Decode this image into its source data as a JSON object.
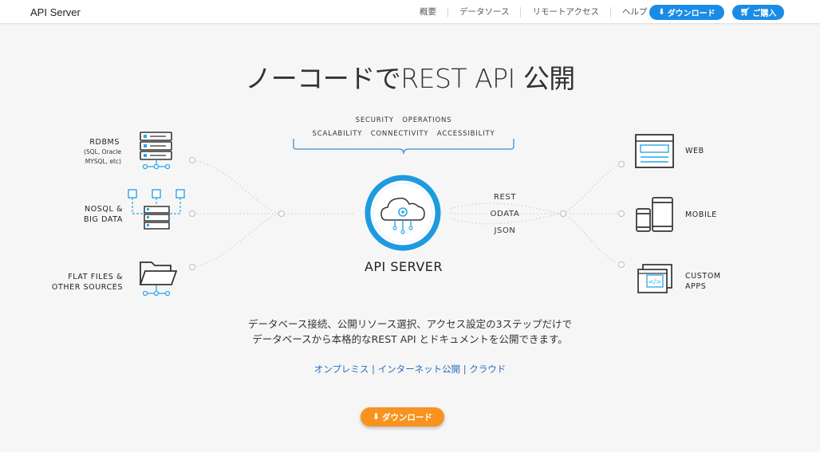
{
  "header": {
    "brand": "API Server",
    "nav": [
      "概要",
      "データソース",
      "リモートアクセス",
      "ヘルプ"
    ],
    "download_label": "ダウンロード",
    "buy_label": "ご購入"
  },
  "hero": {
    "title": "ノーコードでREST API 公開"
  },
  "diagram": {
    "features_top": "SECURITY   OPERATIONS",
    "features_bottom": "SCALABILITY   CONNECTIVITY   ACCESSIBILITY",
    "center_label": "API SERVER",
    "protocols": [
      "REST",
      "ODATA",
      "JSON"
    ],
    "sources": [
      {
        "title": "RDBMS",
        "sub1": "(SQL, Oracle",
        "sub2": "MYSQL, etc)"
      },
      {
        "title": "NOSQL &",
        "sub1": "BIG DATA"
      },
      {
        "title": "FLAT FILES &",
        "sub1": "OTHER SOURCES"
      }
    ],
    "targets": [
      {
        "title": "WEB"
      },
      {
        "title": "MOBILE"
      },
      {
        "title": "CUSTOM",
        "sub1": "APPS"
      }
    ]
  },
  "description": {
    "line1": "データベース接続、公開リソース選択、アクセス設定の3ステップだけで",
    "line2": "データベースから本格的なREST API とドキュメントを公開できます。"
  },
  "links": {
    "onprem": "オンプレミス",
    "internet": "インターネット公開",
    "cloud": "クラウド",
    "sep": " | "
  },
  "cta": {
    "label": "ダウンロード"
  },
  "colors": {
    "accent_blue": "#1a8ce6",
    "cta_orange": "#f7931e",
    "diagram_blue": "#2aa7e8"
  }
}
